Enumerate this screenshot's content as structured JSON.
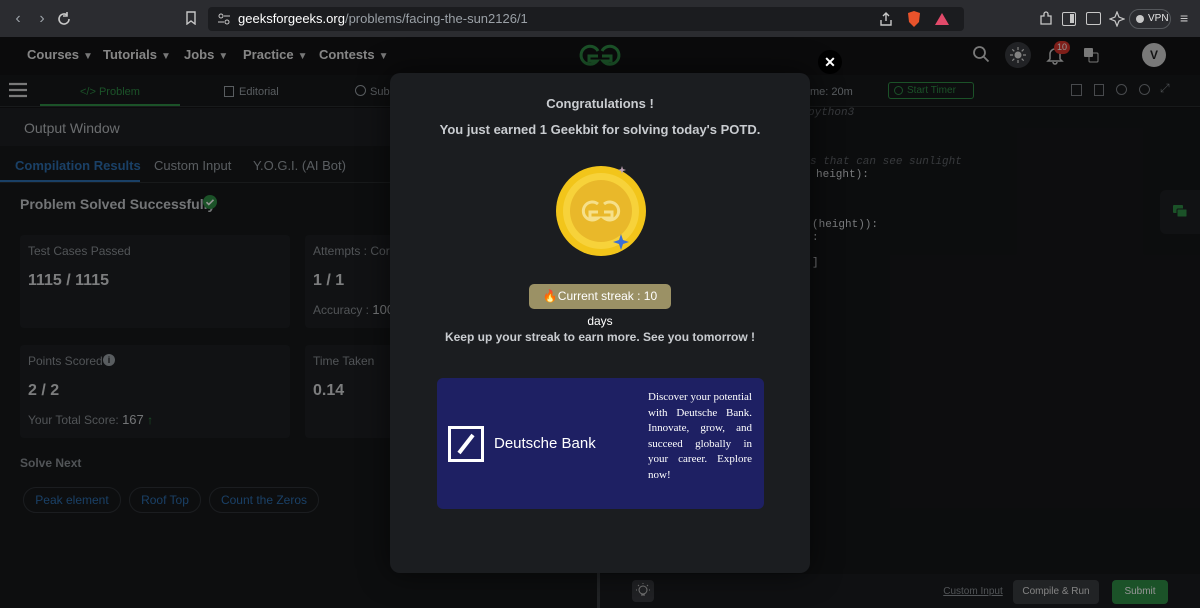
{
  "browser": {
    "url_domain": "geeksforgeeks.org",
    "url_path": "/problems/facing-the-sun2126/1",
    "vpn_label": "VPN"
  },
  "nav": {
    "menus": [
      "Courses",
      "Tutorials",
      "Jobs",
      "Practice",
      "Contests"
    ],
    "logo": "GfG",
    "notification_count": "10",
    "avatar_letter": "V"
  },
  "tabs": {
    "problem": "</> Problem",
    "editorial": "Editorial",
    "submissions": "Subm",
    "time": "me: 20m",
    "start_timer": "Start Timer",
    "language": "python3"
  },
  "output": {
    "title": "Output Window",
    "subtabs": [
      "Compilation Results",
      "Custom Input",
      "Y.O.G.I. (AI Bot)"
    ],
    "status": "Problem Solved Successfully",
    "test_cases_label": "Test Cases Passed",
    "test_cases_value": "1115 / 1115",
    "attempts_label": "Attempts : Corr",
    "attempts_value": "1 / 1",
    "accuracy_label": "Accuracy :",
    "accuracy_value": "100",
    "points_label": "Points Scored",
    "points_value": "2 / 2",
    "total_score_label": "Your Total Score:",
    "total_score_value": "167",
    "time_label": "Time Taken",
    "time_value": "0.14",
    "solve_next_title": "Solve Next",
    "solve_next": [
      "Peak element",
      "Roof Top",
      "Count the Zeros"
    ]
  },
  "editor": {
    "lines": [
      {
        "text": "s that can see sunlight",
        "comment": true
      },
      {
        "text": "height):",
        "comment": false
      },
      {
        "text": "(height)):",
        "comment": false
      },
      {
        "text": ":",
        "comment": false
      },
      {
        "text": "]",
        "comment": false
      }
    ]
  },
  "modal": {
    "title": "Congratulations !",
    "subtitle": "You just earned 1 Geekbit for solving today's POTD.",
    "streak": "Current streak : 10 days",
    "footer": "Keep up your streak to earn more. See you tomorrow !",
    "ad_brand": "Deutsche Bank",
    "ad_text": "Discover your potential with Deutsche Bank. Innovate, grow, and succeed globally in your career. Explore now!"
  },
  "bottom": {
    "custom_input": "Custom Input",
    "compile_run": "Compile & Run",
    "submit": "Submit"
  },
  "colors": {
    "accent_green": "#2f8d46",
    "link_blue": "#2d6fb0",
    "streak_badge": "#9b9165",
    "ad_bg": "#1e2063"
  }
}
